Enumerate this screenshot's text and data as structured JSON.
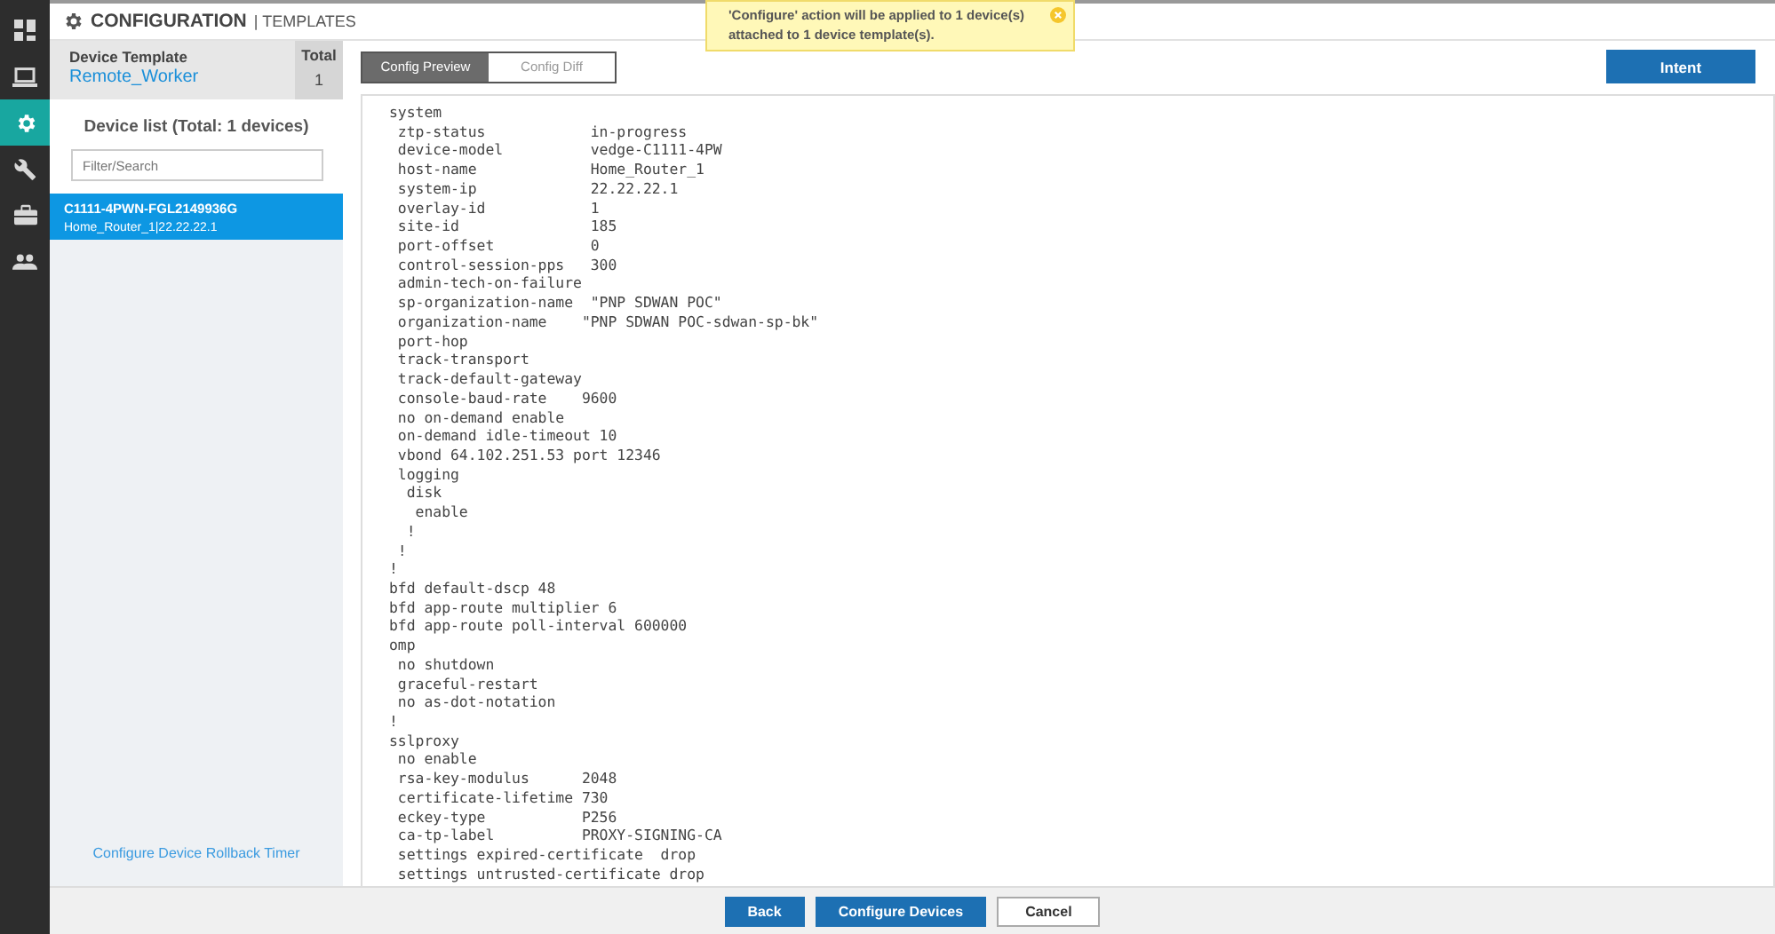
{
  "sidebar": {
    "items": [
      {
        "kind": "grid",
        "selected": false
      },
      {
        "kind": "laptop",
        "selected": false
      },
      {
        "kind": "gear",
        "selected": true
      },
      {
        "kind": "wrench",
        "selected": false
      },
      {
        "kind": "toolbox",
        "selected": false
      },
      {
        "kind": "people",
        "selected": false
      }
    ]
  },
  "header": {
    "title": "CONFIGURATION",
    "subtitle": "| TEMPLATES"
  },
  "notification": {
    "message": "'Configure' action will be applied to 1 device(s) attached to 1 device template(s)."
  },
  "left_panel": {
    "template_label": "Device Template",
    "template_name": "Remote_Worker",
    "total_label": "Total",
    "total_value": "1",
    "device_list_title": "Device list (Total: 1 devices)",
    "search": {
      "placeholder": "Filter/Search"
    },
    "devices": [
      {
        "name": "C1111-4PWN-FGL2149936G",
        "detail": "Home_Router_1|22.22.22.1",
        "selected": true
      }
    ],
    "rollback_link": "Configure Device Rollback Timer"
  },
  "tabs": [
    {
      "label": "Config Preview",
      "selected": true
    },
    {
      "label": "Config Diff",
      "selected": false
    }
  ],
  "intent_button": "Intent",
  "config_lines": [
    "system",
    " ztp-status            in-progress",
    " device-model          vedge-C1111-4PW",
    " host-name             Home_Router_1",
    " system-ip             22.22.22.1",
    " overlay-id            1",
    " site-id               185",
    " port-offset           0",
    " control-session-pps   300",
    " admin-tech-on-failure",
    " sp-organization-name  \"PNP SDWAN POC\"",
    " organization-name    \"PNP SDWAN POC-sdwan-sp-bk\"",
    " port-hop",
    " track-transport",
    " track-default-gateway",
    " console-baud-rate    9600",
    " no on-demand enable",
    " on-demand idle-timeout 10",
    " vbond 64.102.251.53 port 12346",
    " logging",
    "  disk",
    "   enable",
    "  !",
    " !",
    "!",
    "bfd default-dscp 48",
    "bfd app-route multiplier 6",
    "bfd app-route poll-interval 600000",
    "omp",
    " no shutdown",
    " graceful-restart",
    " no as-dot-notation",
    "!",
    "sslproxy",
    " no enable",
    " rsa-key-modulus      2048",
    " certificate-lifetime 730",
    " eckey-type           P256",
    " ca-tp-label          PROXY-SIGNING-CA",
    " settings expired-certificate  drop",
    " settings untrusted-certificate drop"
  ],
  "footer_buttons": [
    {
      "label": "Back",
      "kind": "primary"
    },
    {
      "label": "Configure Devices",
      "kind": "primary"
    },
    {
      "label": "Cancel",
      "kind": "secondary"
    }
  ]
}
